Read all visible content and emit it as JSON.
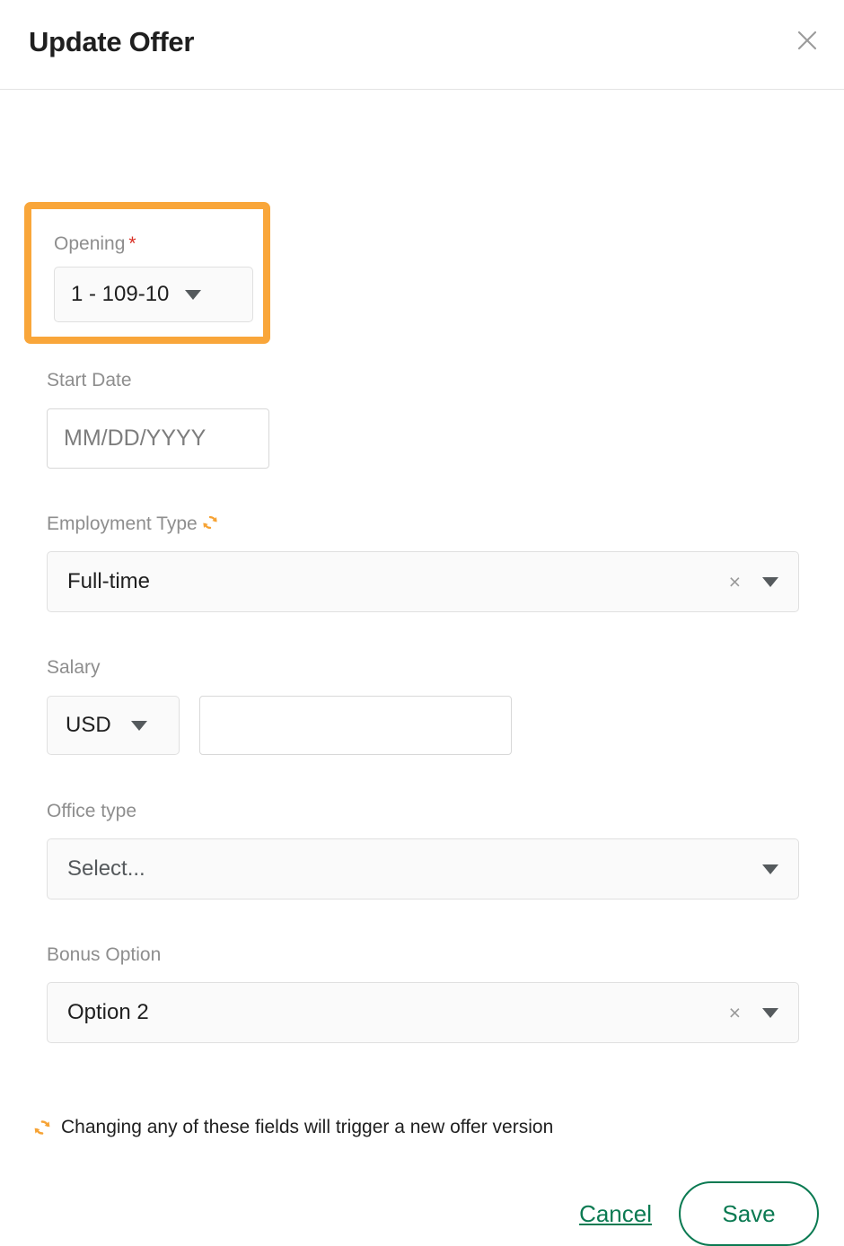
{
  "modal": {
    "title": "Update Offer",
    "close_icon": "close-icon"
  },
  "fields": {
    "opening": {
      "label": "Opening",
      "required_marker": "*",
      "value": "1 - 109-10",
      "highlighted": true
    },
    "start_date": {
      "label": "Start Date",
      "value": "",
      "placeholder": "MM/DD/YYYY"
    },
    "employment_type": {
      "label": "Employment Type",
      "value": "Full-time",
      "has_version_icon": true,
      "clear_label": "×"
    },
    "salary": {
      "label": "Salary",
      "currency": "USD",
      "amount": "",
      "amount_placeholder": ""
    },
    "office_type": {
      "label": "Office type",
      "value": "Select..."
    },
    "bonus_option": {
      "label": "Bonus Option",
      "value": "Option 2",
      "clear_label": "×"
    }
  },
  "footer": {
    "note": "Changing any of these fields will trigger a new offer version",
    "note_icon": "sync-icon",
    "cancel_label": "Cancel",
    "save_label": "Save"
  },
  "colors": {
    "highlight_orange": "#f9a63a",
    "sync_orange": "#f6a335",
    "required_red": "#d93025",
    "accent_green": "#0b7a52",
    "label_gray": "#8e8e8e",
    "field_bg": "#fafafa"
  }
}
